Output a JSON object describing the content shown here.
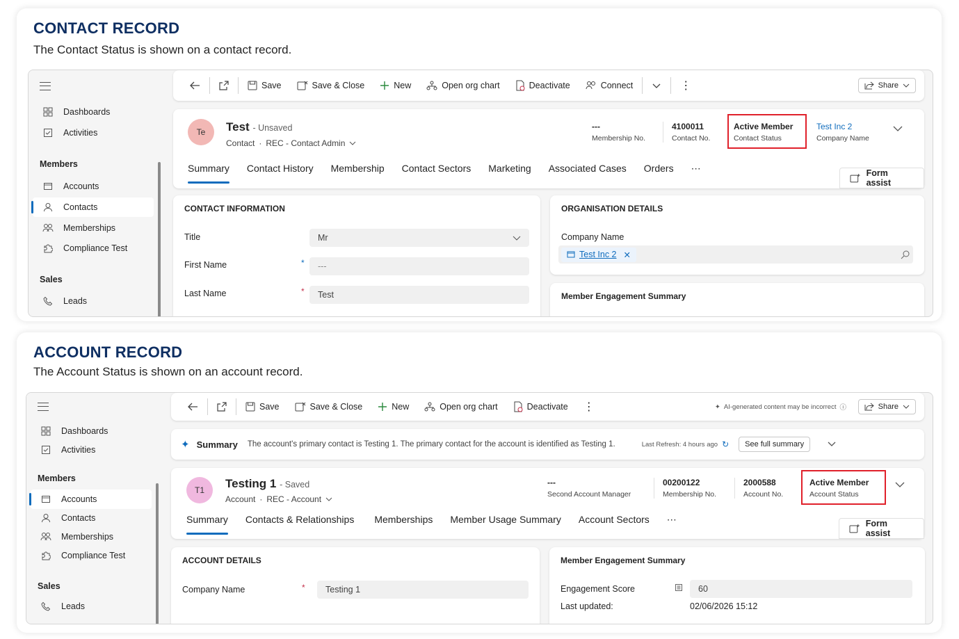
{
  "contact_card": {
    "title": "CONTACT RECORD",
    "subtitle": "The Contact Status is shown on a contact record.",
    "sidebar": {
      "items_top": [
        {
          "label": "Dashboards",
          "icon": "dashboard-icon"
        },
        {
          "label": "Activities",
          "icon": "activities-icon"
        }
      ],
      "group_members": "Members",
      "members": [
        {
          "label": "Accounts"
        },
        {
          "label": "Contacts",
          "active": true
        },
        {
          "label": "Memberships"
        },
        {
          "label": "Compliance Test"
        }
      ],
      "group_sales": "Sales",
      "sales": [
        {
          "label": "Leads"
        }
      ]
    },
    "commands": {
      "save": "Save",
      "save_close": "Save & Close",
      "new": "New",
      "org_chart": "Open org chart",
      "deactivate": "Deactivate",
      "connect": "Connect",
      "share": "Share"
    },
    "header": {
      "initials": "Te",
      "name": "Test",
      "status_suffix": "- Unsaved",
      "entity": "Contact",
      "form": "REC - Contact Admin",
      "fields": [
        {
          "value": "---",
          "label": "Membership No."
        },
        {
          "value": "4100011",
          "label": "Contact No."
        },
        {
          "value": "Active Member",
          "label": "Contact Status"
        },
        {
          "value": "Test Inc 2",
          "label": "Company Name"
        }
      ]
    },
    "tabs": [
      "Summary",
      "Contact History",
      "Membership",
      "Contact Sectors",
      "Marketing",
      "Associated Cases",
      "Orders"
    ],
    "form_assist": "Form assist",
    "contact_info": {
      "title": "CONTACT INFORMATION",
      "title_label": "Title",
      "title_value": "Mr",
      "first_name_label": "First Name",
      "first_name_value": "---",
      "last_name_label": "Last Name",
      "last_name_value": "Test"
    },
    "org_details": {
      "title": "ORGANISATION DETAILS",
      "company_label": "Company Name",
      "company_value": "Test Inc 2"
    },
    "engagement_title": "Member Engagement Summary"
  },
  "account_card": {
    "title": "ACCOUNT RECORD",
    "subtitle": "The Account Status is shown on an account record.",
    "sidebar": {
      "items_top": [
        {
          "label": "Dashboards"
        },
        {
          "label": "Activities"
        }
      ],
      "group_members": "Members",
      "members": [
        {
          "label": "Accounts",
          "active": true
        },
        {
          "label": "Contacts"
        },
        {
          "label": "Memberships"
        },
        {
          "label": "Compliance Test"
        }
      ],
      "group_sales": "Sales",
      "sales": [
        {
          "label": "Leads"
        }
      ]
    },
    "commands": {
      "save": "Save",
      "save_close": "Save & Close",
      "new": "New",
      "org_chart": "Open org chart",
      "deactivate": "Deactivate",
      "ai_note": "AI-generated content may be incorrect",
      "share": "Share"
    },
    "summary": {
      "label": "Summary",
      "text": "The account's primary contact is Testing 1. The primary contact for the account is identified as Testing 1.",
      "refresh": "Last Refresh: 4 hours ago",
      "see_full": "See full summary"
    },
    "header": {
      "initials": "T1",
      "name": "Testing 1",
      "status_suffix": "- Saved",
      "entity": "Account",
      "form": "REC - Account",
      "fields": [
        {
          "value": "---",
          "label": "Second Account Manager"
        },
        {
          "value": "00200122",
          "label": "Membership No."
        },
        {
          "value": "2000588",
          "label": "Account No."
        },
        {
          "value": "Active Member",
          "label": "Account Status"
        }
      ]
    },
    "tabs": [
      "Summary",
      "Contacts & Relationships",
      "Memberships",
      "Member Usage Summary",
      "Account Sectors"
    ],
    "form_assist": "Form assist",
    "account_details": {
      "title": "ACCOUNT DETAILS",
      "company_label": "Company Name",
      "company_value": "Testing 1"
    },
    "engagement": {
      "title": "Member Engagement Summary",
      "score_label": "Engagement Score",
      "score_value": "60",
      "updated_label": "Last updated:",
      "updated_value": "02/06/2026 15:12"
    }
  },
  "colors": {
    "accent": "#0f6cbd",
    "title": "#0f2f62",
    "highlight": "#e0202a"
  }
}
